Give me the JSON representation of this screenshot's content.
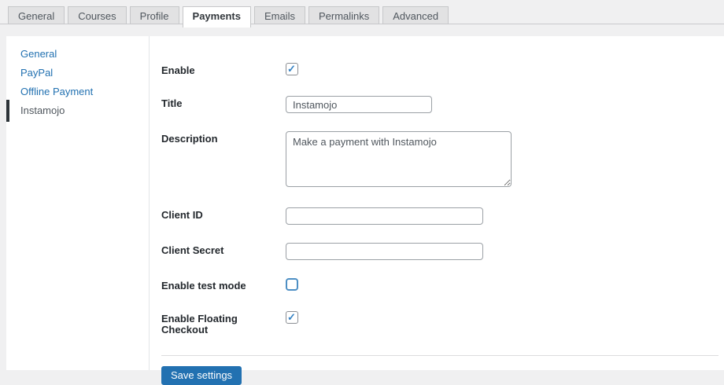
{
  "tabs": {
    "items": [
      "General",
      "Courses",
      "Profile",
      "Payments",
      "Emails",
      "Permalinks",
      "Advanced"
    ],
    "active": "Payments"
  },
  "sidebar": {
    "items": [
      "General",
      "PayPal",
      "Offline Payment",
      "Instamojo"
    ],
    "active": "Instamojo"
  },
  "form": {
    "enable": {
      "label": "Enable",
      "checked": "checked"
    },
    "title": {
      "label": "Title",
      "value": "Instamojo"
    },
    "description": {
      "label": "Description",
      "value": "Make a payment with Instamojo"
    },
    "client_id": {
      "label": "Client ID",
      "value": ""
    },
    "client_secret": {
      "label": "Client Secret",
      "value": ""
    },
    "test_mode": {
      "label": "Enable test mode"
    },
    "floating_checkout": {
      "label": "Enable Floating Checkout",
      "checked": "checked"
    },
    "save_label": "Save settings"
  },
  "colors": {
    "page_bg": "#f0f0f1",
    "link_blue": "#2271b1",
    "active_marker": "#2c3338",
    "checkmark_blue": "#3582c4",
    "button_blue": "#2271b1"
  }
}
